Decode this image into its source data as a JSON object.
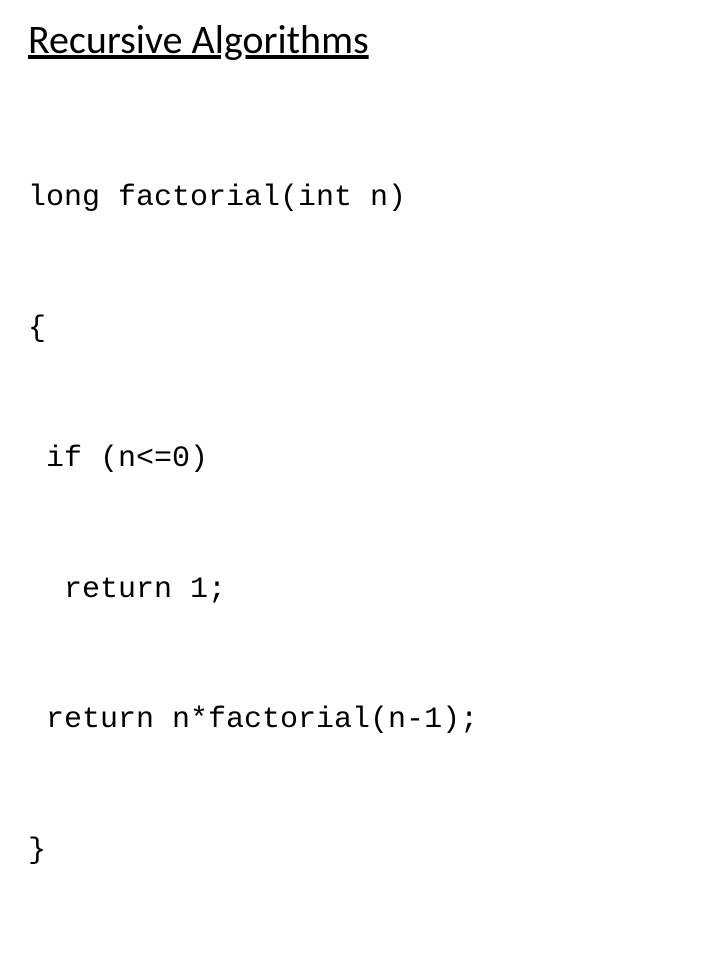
{
  "title": "Recursive Algorithms",
  "code": {
    "line1": "long factorial(int n)",
    "line2": "{",
    "line3": " if (n<=0)",
    "line4": "  return 1;",
    "line5": " return n*factorial(n-1);",
    "line6": "}"
  }
}
